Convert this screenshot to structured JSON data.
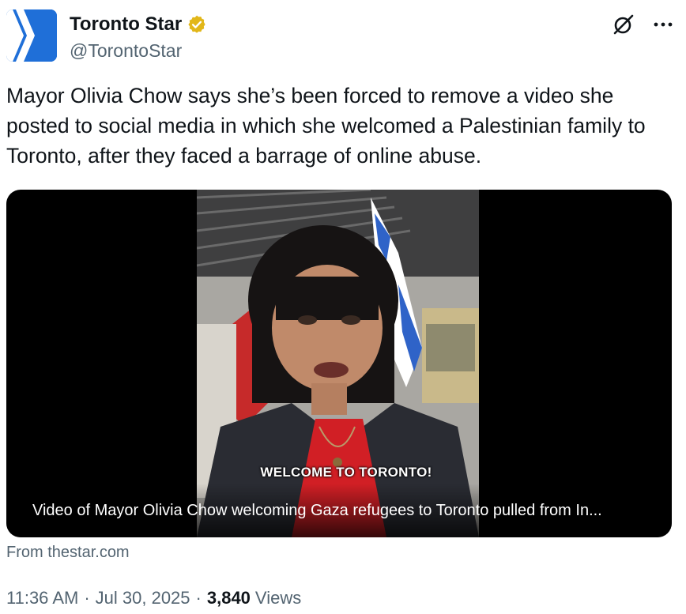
{
  "author": {
    "display_name": "Toronto Star",
    "handle": "@TorontoStar",
    "verified_color": "#e2b719",
    "avatar_color": "#1f6fd8",
    "icons": [
      "verified-badge-icon",
      "grok-icon",
      "more-icon"
    ]
  },
  "tweet": {
    "text": "Mayor Olivia Chow says she’s been forced to remove a video she posted to social media in which she welcomed a Palestinian family to Toronto, after they faced a barrage of online abuse."
  },
  "card": {
    "overlay_text": "WELCOME TO TORONTO!",
    "caption": "Video of Mayor Olivia Chow welcoming Gaza refugees to Toronto pulled from In...",
    "source": "From thestar.com"
  },
  "meta": {
    "time": "11:36 AM",
    "date": "Jul 30, 2025",
    "separator": "·",
    "views_count": "3,840",
    "views_label": "Views"
  }
}
